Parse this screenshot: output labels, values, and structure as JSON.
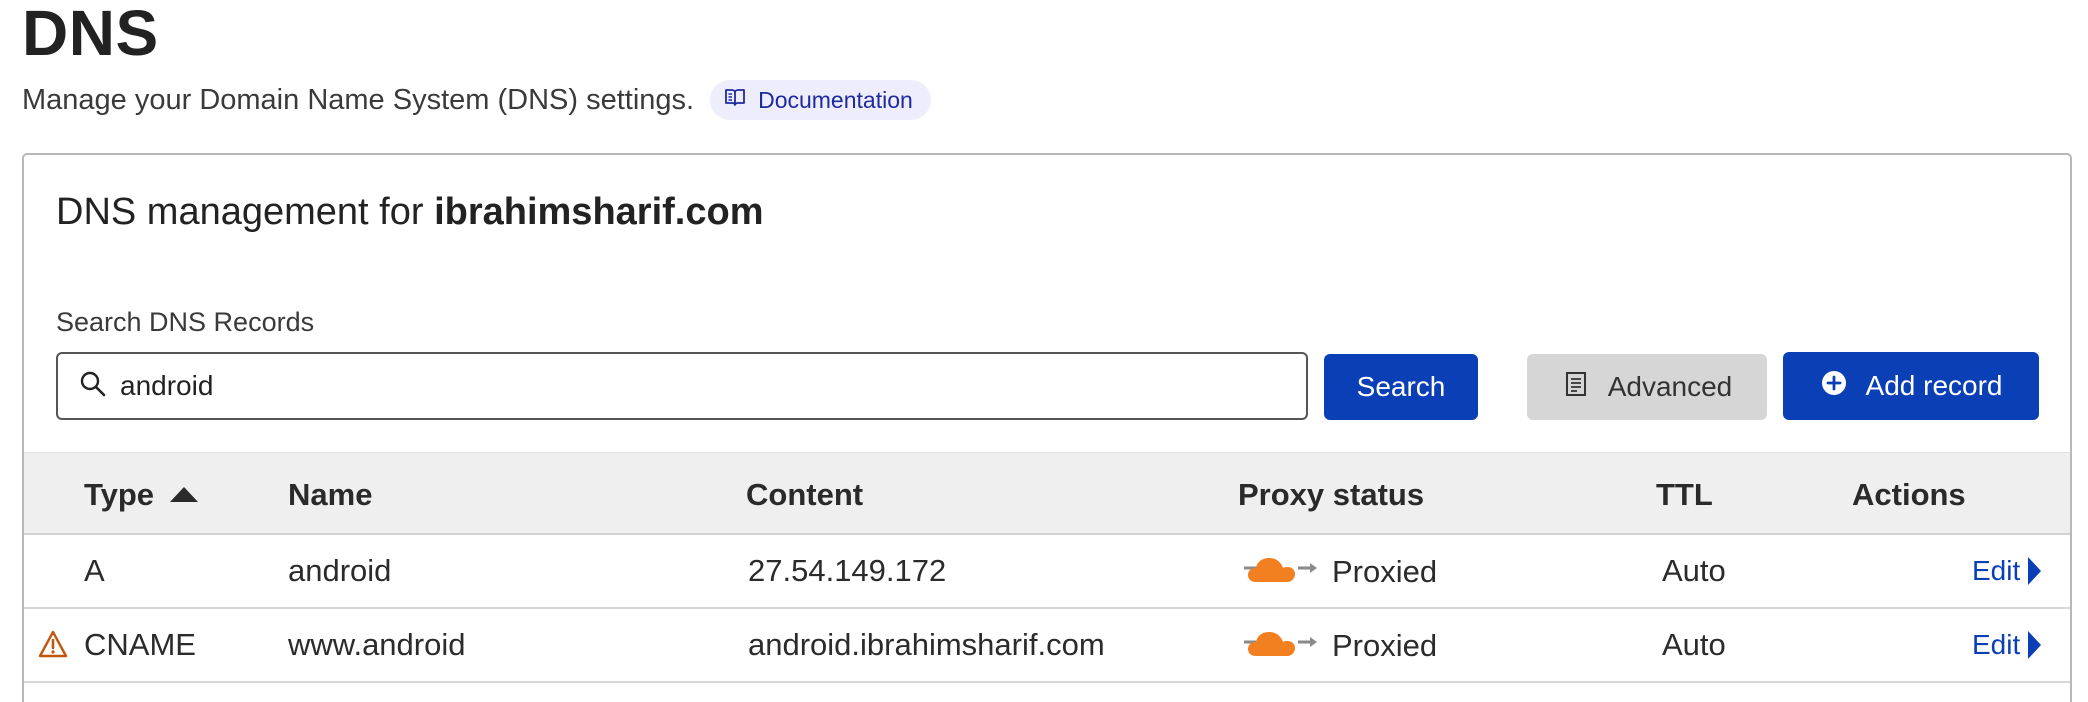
{
  "header": {
    "title": "DNS",
    "subtitle": "Manage your Domain Name System (DNS) settings.",
    "doc_link": "Documentation"
  },
  "card": {
    "title_prefix": "DNS management for ",
    "domain": "ibrahimsharif.com"
  },
  "search": {
    "label": "Search DNS Records",
    "value": "android",
    "button": "Search"
  },
  "actions": {
    "advanced": "Advanced",
    "add_record": "Add record"
  },
  "table": {
    "headers": {
      "type": "Type",
      "name": "Name",
      "content": "Content",
      "proxy": "Proxy status",
      "ttl": "TTL",
      "actions": "Actions"
    },
    "rows": [
      {
        "type": "A",
        "name": "android",
        "content": "27.54.149.172",
        "proxy": "Proxied",
        "ttl": "Auto",
        "action": "Edit",
        "warning": false
      },
      {
        "type": "CNAME",
        "name": "www.android",
        "content": "android.ibrahimsharif.com",
        "proxy": "Proxied",
        "ttl": "Auto",
        "action": "Edit",
        "warning": true
      }
    ]
  },
  "icons": {
    "doc": "book-icon",
    "search": "search-icon",
    "advanced": "document-list-icon",
    "add": "plus-circle-icon",
    "proxy": "orange-cloud-icon",
    "warning": "warning-icon",
    "sort": "sort-ascending-icon"
  },
  "colors": {
    "primary": "#0a3fb5",
    "cloud": "#f38020",
    "warning": "#c2570c",
    "pill_bg": "#eeedfb"
  }
}
